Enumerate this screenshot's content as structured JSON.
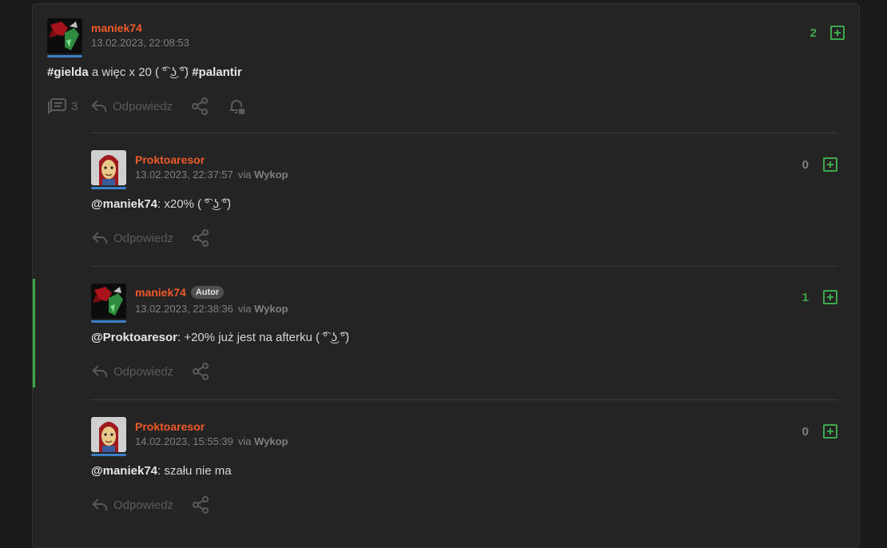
{
  "main_post": {
    "author": "maniek74",
    "date": "13.02.2023, 22:08:53",
    "votes": "2",
    "tag1": "#gielda",
    "text_middle": " a więc x 20 ( ͡° ͜ʖ ͡°) ",
    "tag2": "#palantir",
    "comments_count": "3",
    "reply_label": "Odpowiedz"
  },
  "comments": [
    {
      "author": "Proktoaresor",
      "date": "13.02.2023, 22:37:57",
      "via_prefix": "via ",
      "via": "Wykop",
      "votes": "0",
      "mention": "@maniek74",
      "text": ": x20% ( ͡° ͜ʖ ͡°)",
      "reply_label": "Odpowiedz"
    },
    {
      "author": "maniek74",
      "badge": "Autor",
      "date": "13.02.2023, 22:38:36",
      "via_prefix": "via ",
      "via": "Wykop",
      "votes": "1",
      "mention": "@Proktoaresor",
      "text": ": +20% już jest na afterku ( ͡° ͜ʖ ͡°)",
      "reply_label": "Odpowiedz"
    },
    {
      "author": "Proktoaresor",
      "date": "14.02.2023, 15:55:39",
      "via_prefix": "via ",
      "via": "Wykop",
      "votes": "0",
      "mention": "@maniek74",
      "text": ": szału nie ma",
      "reply_label": "Odpowiedz"
    }
  ],
  "colors": {
    "author": "#f05a28",
    "vote_positive": "#3ea84c",
    "vote_zero": "#7f7f80",
    "accent_bar": "#3ea84c"
  },
  "icons": [
    "comments-icon",
    "reply-icon",
    "share-icon",
    "notification-bell-icon",
    "plus-vote-icon"
  ]
}
